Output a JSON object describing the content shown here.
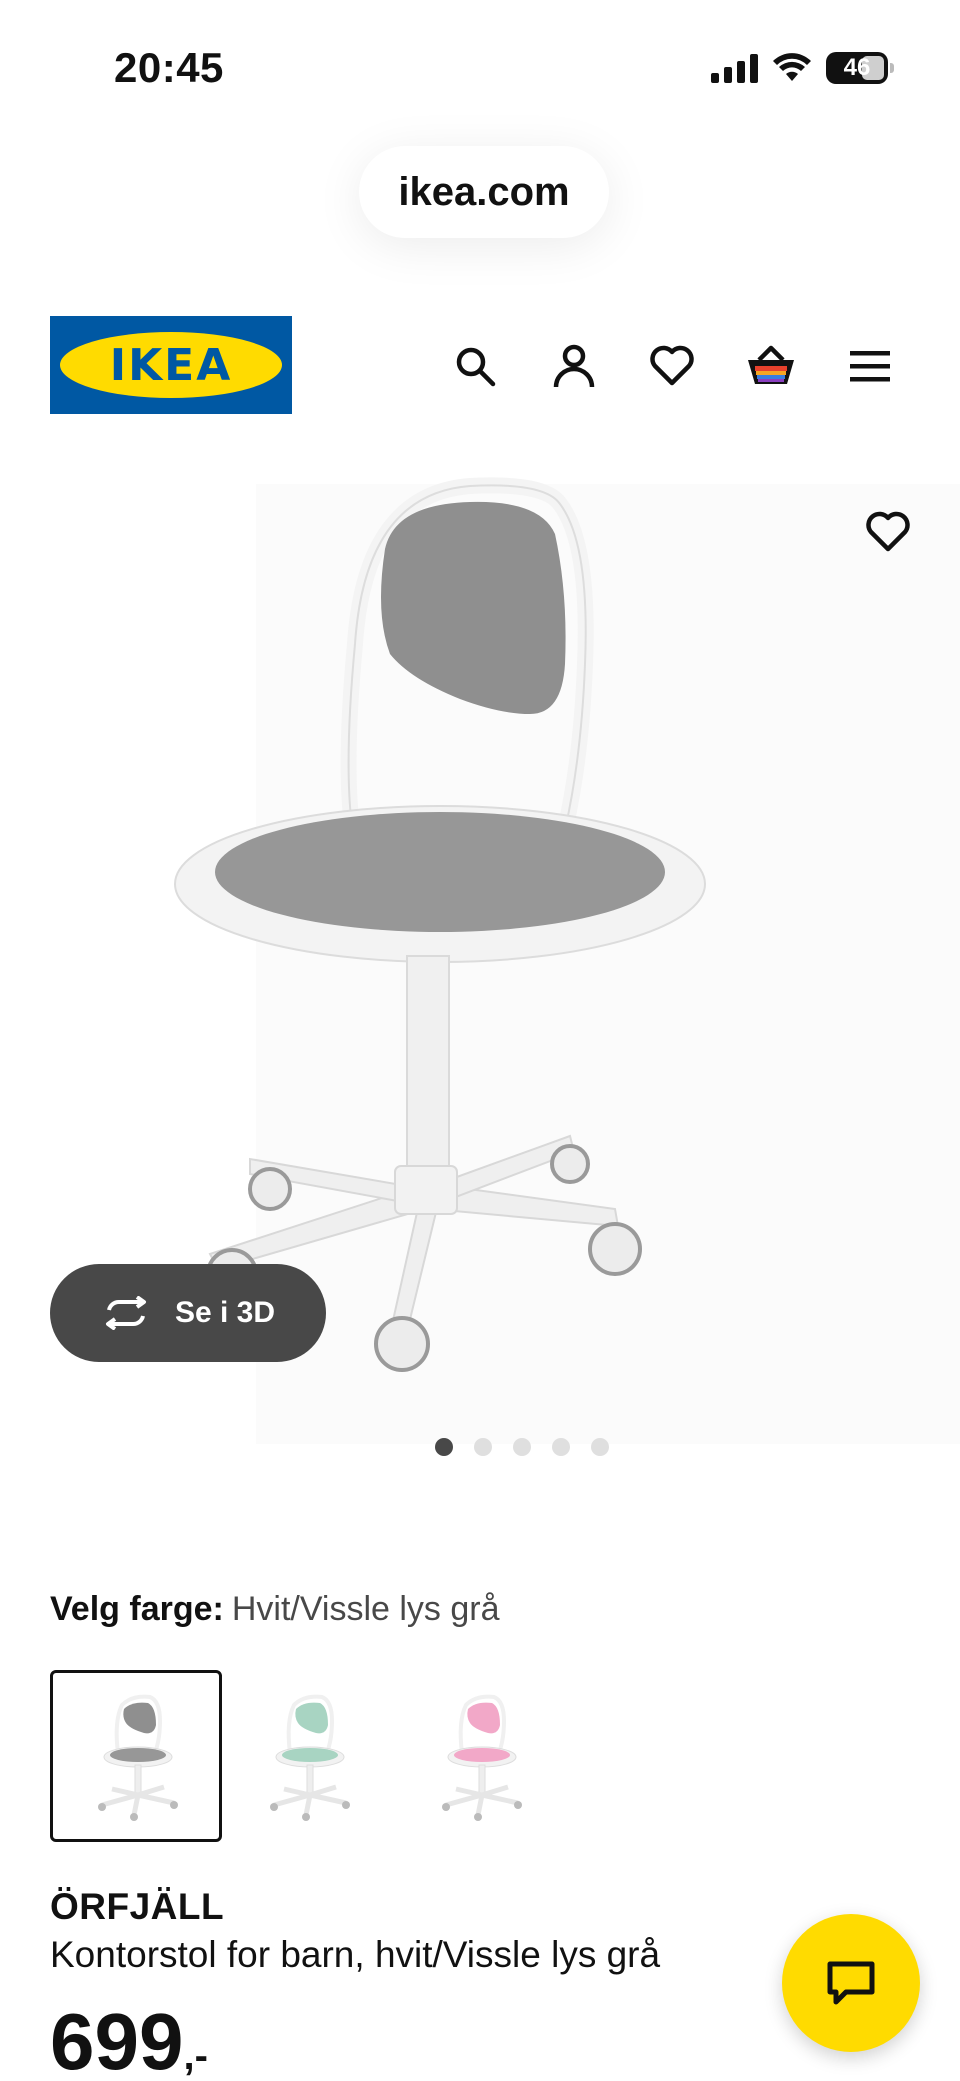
{
  "status_bar": {
    "time": "20:45",
    "battery_level": "46"
  },
  "browser": {
    "url": "ikea.com"
  },
  "header": {
    "logo_text": "IKEA",
    "icons": [
      "search-icon",
      "account-icon",
      "wishlist-icon",
      "cart-icon",
      "menu-icon"
    ]
  },
  "gallery": {
    "view_3d_label": "Se i 3D",
    "image_count": 5,
    "active_index": 0
  },
  "product": {
    "color_label": "Velg farge:",
    "color_value": "Hvit/Vissle lys grå",
    "swatches": [
      {
        "color": "gray",
        "selected": true
      },
      {
        "color": "green",
        "selected": false
      },
      {
        "color": "pink",
        "selected": false
      }
    ],
    "name": "ÖRFJÄLL",
    "description": "Kontorstol for barn, hvit/Vissle lys grå",
    "price": "699",
    "price_suffix": ",-"
  },
  "colors": {
    "ikea_blue": "#0058a3",
    "ikea_yellow": "#ffdb00",
    "dark_pill": "#484848"
  }
}
